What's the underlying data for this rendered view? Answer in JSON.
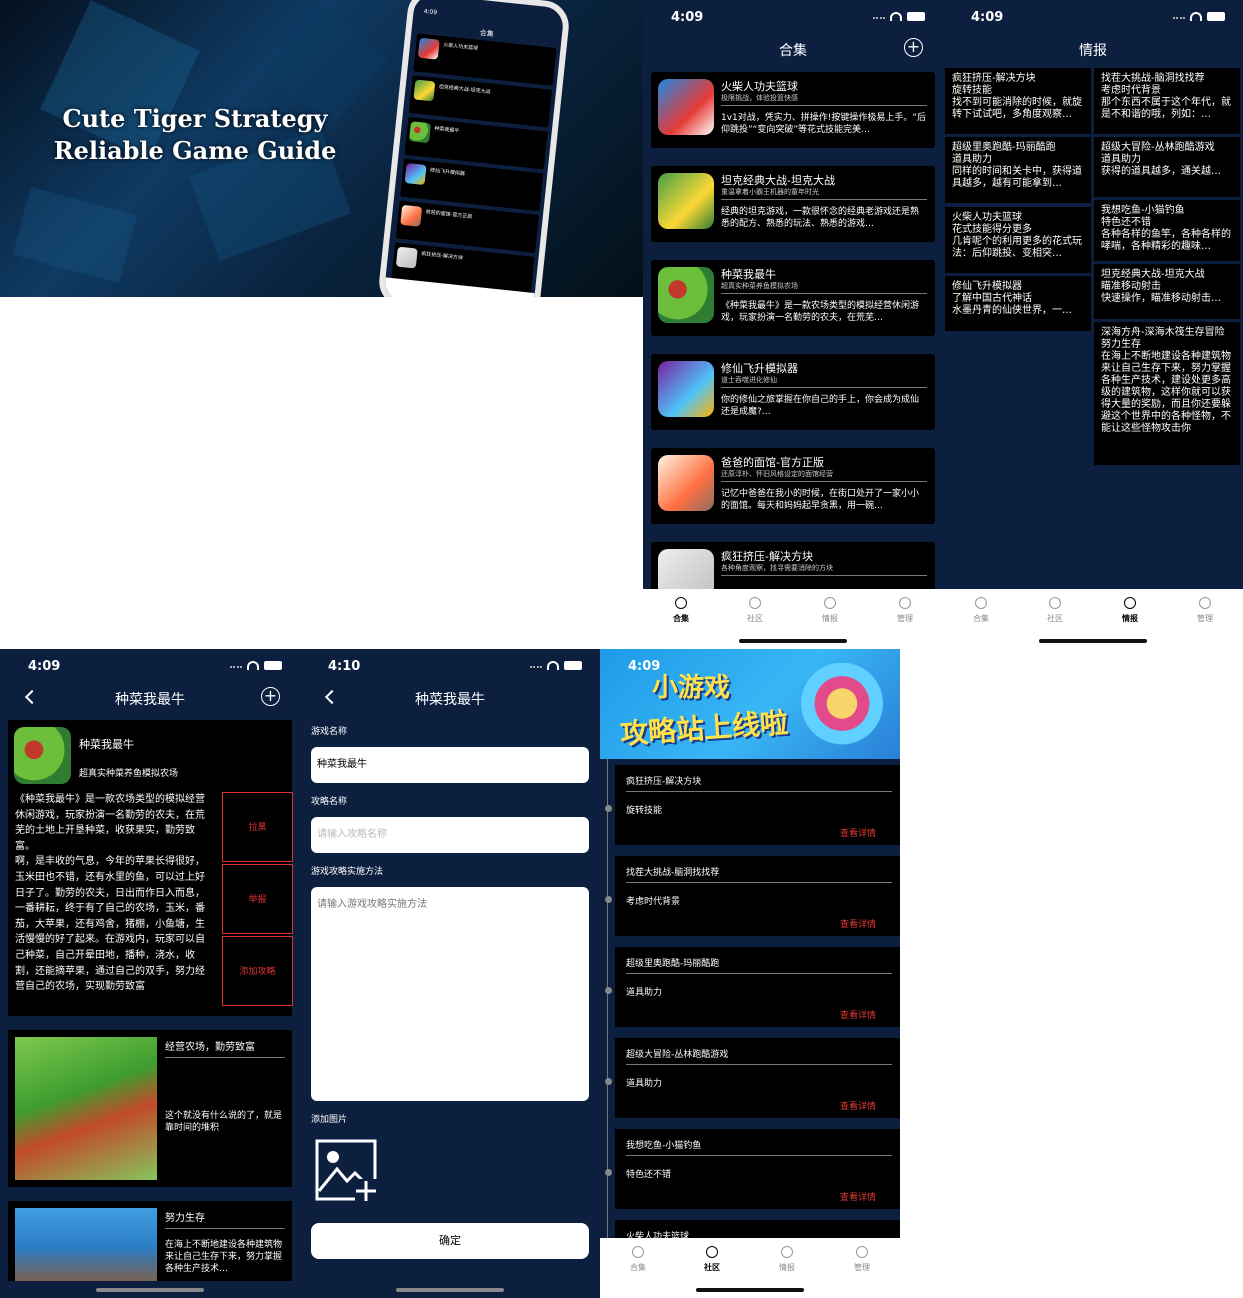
{
  "promo": {
    "line1": "Cute Tiger Strategy",
    "line2": "Reliable Game Guide"
  },
  "mini": {
    "time": "4:09",
    "title": "合集",
    "items": [
      "火柴人功夫篮球",
      "坦克经典大战-坦克大战",
      "种菜我最牛",
      "修仙飞升模拟器",
      "爸爸的面馆-官方正版",
      "疯狂挤压-解决方块"
    ]
  },
  "tabs": {
    "collection": "合集",
    "community": "社区",
    "intel": "情报",
    "manage": "管理"
  },
  "colors": {
    "navy": "#0d1f3f",
    "accent_red": "#e53935"
  },
  "screen1": {
    "time": "4:09",
    "title": "合集",
    "cards": [
      {
        "name": "火柴人功夫篮球",
        "sub": "极限挑战，体验投篮快感",
        "desc": "1v1对战，凭实力、拼操作!按键操作极易上手。“后仰跳投”“变向突破”等花式技能完美…"
      },
      {
        "name": "坦克经典大战-坦克大战",
        "sub": "重温拿着小霸王机器的童年时光",
        "desc": "经典的坦克游戏，一款很怀念的经典老游戏还是熟悉的配方、熟悉的玩法、熟悉的游戏…"
      },
      {
        "name": "种菜我最牛",
        "sub": "超真实种菜养鱼模拟农场",
        "desc": "《种菜我最牛》是一款农场类型的模拟经营休闲游戏，玩家扮演一名勤劳的农夫，在荒芜…"
      },
      {
        "name": "修仙飞升模拟器",
        "sub": "道士吞噬进化修仙",
        "desc": "你的修仙之旅掌握在你自己的手上，你会成为成仙还是成魔?…"
      },
      {
        "name": "爸爸的面馆-官方正版",
        "sub": "还原淳朴、怀旧风格设定的面馆经营",
        "desc": "记忆中爸爸在我小的时候，在街口处开了一家小小的面馆。每天和妈妈起早贪黑，用一碗…"
      },
      {
        "name": "疯狂挤压-解决方块",
        "sub": "各种角度观察，找寻需要消除的方块",
        "desc": ""
      }
    ]
  },
  "screen2": {
    "time": "4:09",
    "title": "情报",
    "left": [
      [
        "疯狂挤压-解决方块",
        "旋转技能",
        "找不到可能消除的时候，就旋转下试试吧，多角度观察…"
      ],
      [
        "超级里奥跑酷-玛丽酷跑",
        "道具助力",
        "同样的时间和关卡中，获得道具越多，越有可能拿到…"
      ],
      [
        "火柴人功夫篮球",
        "花式技能得分更多",
        "几肯呢个的利用更多的花式玩法：后仰跳投、变相突…"
      ],
      [
        "修仙飞升模拟器",
        "了解中国古代神话",
        "水墨丹青的仙侠世界，一…"
      ]
    ],
    "right": [
      [
        "找茬大挑战-脑洞找找荐",
        "考虑时代背景",
        "那个东西不属于这个年代，就是不和谐的哦，列如：…"
      ],
      [
        "超级大冒险-丛林跑酷游戏",
        "道具助力",
        "获得的道具越多，通关越…"
      ],
      [
        "我想吃鱼-小猫钓鱼",
        "特色还不错",
        "各种各样的鱼竿，各种各样的哮喘，各种精彩的趣味…"
      ],
      [
        "坦克经典大战-坦克大战",
        "瞄准移动射击",
        "快速操作，瞄准移动射击…"
      ],
      [
        "深海方舟-深海木筏生存冒险",
        "努力生存",
        "在海上不断地建设各种建筑物来让自己生存下来，努力掌握各种生产技术，建设处更多高级的建筑物，这样你就可以获得大量的奖励，而且你还要躲避这个世界中的各种怪物，不能让这些怪物攻击你"
      ]
    ]
  },
  "screen3": {
    "time": "4:09",
    "title": "种菜我最牛",
    "name": "种菜我最牛",
    "sub": "超真实种菜养鱼模拟农场",
    "desc": "《种菜我最牛》是一款农场类型的模拟经营休闲游戏，玩家扮演一名勤劳的农夫，在荒芜的土地上开垦种菜，收获果实，勤劳致富。\n啊，是丰收的气息，今年的苹果长得很好，玉米田也不错，还有水里的鱼，可以过上好日子了。勤劳的农夫，日出而作日入而息，一番耕耘，终于有了自己的农场，玉米，番茄，大苹果，还有鸡舍，猪棚，小鱼塘，生活慢慢的好了起来。在游戏内，玩家可以自己种菜，自己开晕田地，播种，浇水，收割，还能摘苹果，通过自己的双手，努力经营自己的农场，实现勤劳致富",
    "btns": [
      "拉黑",
      "举报",
      "添加攻略"
    ],
    "posts": [
      {
        "title": "经营农场，勤劳致富",
        "text": "这个就没有什么说的了，就是靠时间的堆积"
      },
      {
        "title": "努力生存",
        "text": "在海上不断地建设各种建筑物来让自己生存下来，努力掌握各种生产技术…"
      }
    ]
  },
  "screen4": {
    "time": "4:10",
    "title": "种菜我最牛",
    "lbl_game": "游戏名称",
    "val_game": "种菜我最牛",
    "lbl_guide": "攻略名称",
    "ph_guide": "请输入攻略名称",
    "lbl_method": "游戏攻略实施方法",
    "ph_method": "请输入游戏攻略实施方法",
    "lbl_img": "添加图片",
    "ok": "确定"
  },
  "screen5": {
    "time": "4:09",
    "banner1": "小游戏",
    "banner2": "攻略站上线啦",
    "items": [
      {
        "h": "疯狂挤压-解决方块",
        "d": "旋转技能"
      },
      {
        "h": "找茬大挑战-脑洞找找荐",
        "d": "考虑时代背景"
      },
      {
        "h": "超级里奥跑酷-玛丽酷跑",
        "d": "道具助力"
      },
      {
        "h": "超级大冒险-丛林跑酷游戏",
        "d": "道具助力"
      },
      {
        "h": "我想吃鱼-小猫钓鱼",
        "d": "特色还不错"
      },
      {
        "h": "火柴人功夫篮球",
        "d": ""
      }
    ],
    "link": "查看详情"
  }
}
